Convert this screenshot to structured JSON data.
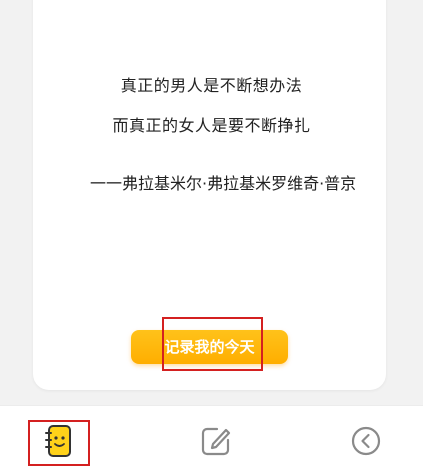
{
  "quote": {
    "line1": "真正的男人是不断想办法",
    "line2": "而真正的女人是要不断挣扎",
    "attribution": "一一弗拉基米尔·弗拉基米罗维奇·普京"
  },
  "cta": {
    "label": "记录我的今天"
  },
  "nav": {
    "items": [
      {
        "icon": "smiley-notebook-icon"
      },
      {
        "icon": "edit-icon"
      },
      {
        "icon": "back-circle-icon"
      }
    ]
  },
  "colors": {
    "accent": "#ffb300",
    "highlight": "#d42020",
    "icon": "#8a8a8a"
  }
}
